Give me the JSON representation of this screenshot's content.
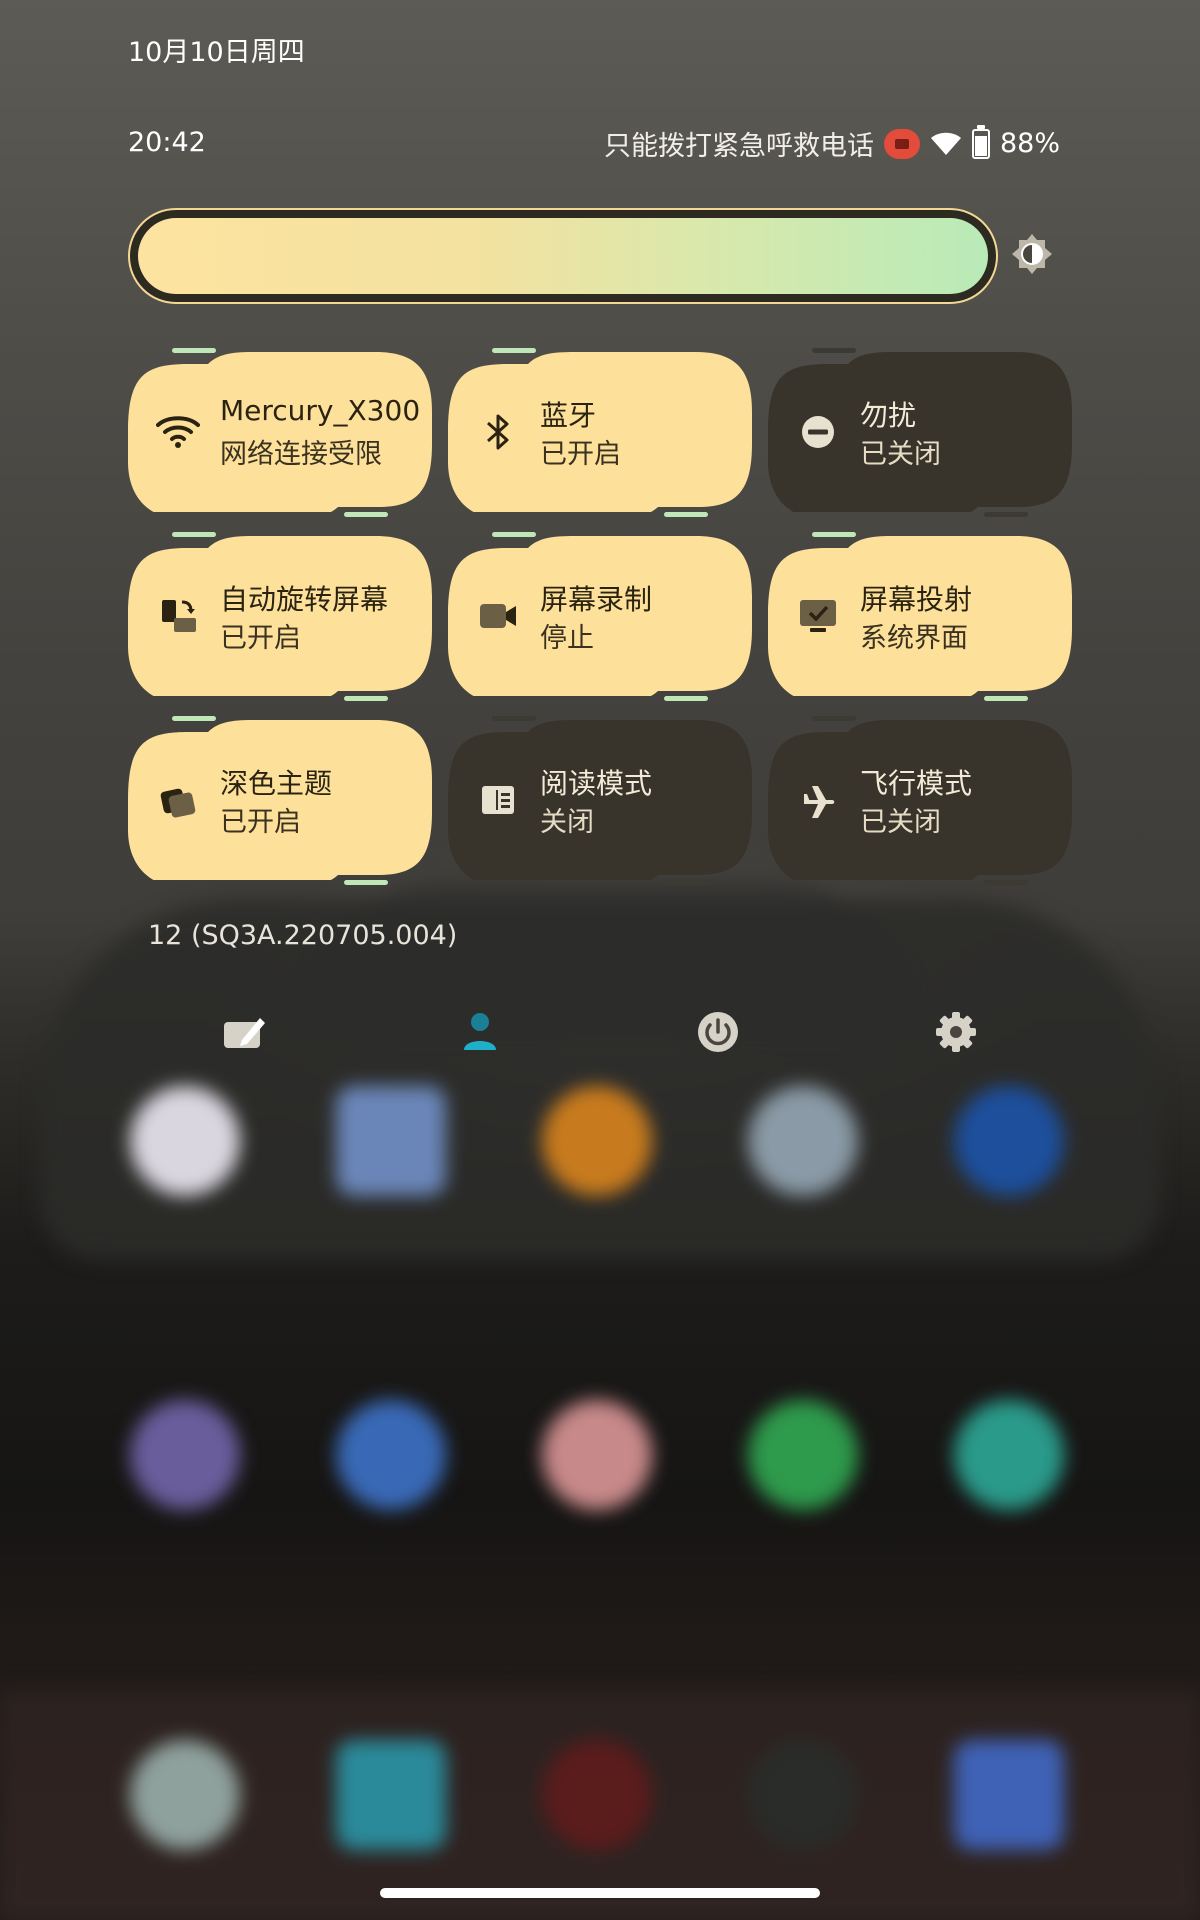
{
  "date": "10月10日周四",
  "time": "20:42",
  "status": {
    "carrier_text": "只能拨打紧急呼救电话",
    "battery_percent": "88%",
    "screen_recording_active": true
  },
  "brightness": {
    "level_fraction": 1.0
  },
  "tiles": [
    {
      "id": "wifi",
      "title": "Mercury_X300",
      "subtitle": "网络连接受限",
      "state": "on",
      "icon": "wifi-icon"
    },
    {
      "id": "bluetooth",
      "title": "蓝牙",
      "subtitle": "已开启",
      "state": "on",
      "icon": "bluetooth-icon"
    },
    {
      "id": "dnd",
      "title": "勿扰",
      "subtitle": "已关闭",
      "state": "off",
      "icon": "do-not-disturb-icon"
    },
    {
      "id": "autorotate",
      "title": "自动旋转屏幕",
      "subtitle": "已开启",
      "state": "on",
      "icon": "auto-rotate-icon"
    },
    {
      "id": "screenrecord",
      "title": "屏幕录制",
      "subtitle": "停止",
      "state": "on",
      "icon": "screen-record-icon"
    },
    {
      "id": "cast",
      "title": "屏幕投射",
      "subtitle": "系统界面",
      "state": "on",
      "icon": "cast-icon"
    },
    {
      "id": "darktheme",
      "title": "深色主题",
      "subtitle": "已开启",
      "state": "on",
      "icon": "dark-theme-icon"
    },
    {
      "id": "reading",
      "title": "阅读模式",
      "subtitle": "关闭",
      "state": "off",
      "icon": "reading-mode-icon"
    },
    {
      "id": "airplane",
      "title": "飞行模式",
      "subtitle": "已关闭",
      "state": "off",
      "icon": "airplane-icon"
    }
  ],
  "build_number": "12 (SQ3A.220705.004)",
  "footer": {
    "edit": "edit-icon",
    "user": "user-icon",
    "power": "power-icon",
    "settings": "settings-icon"
  },
  "colors": {
    "tile_on": "#fde09a",
    "tile_off": "#38342b",
    "accent_green": "#bfe7b7"
  }
}
